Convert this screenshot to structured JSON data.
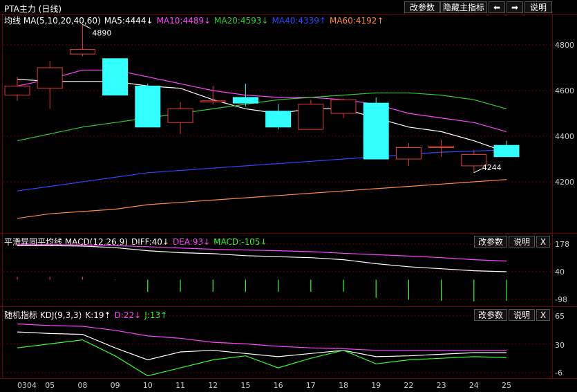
{
  "header": {
    "symbol": "PTA主力 (日线)",
    "btn_params": "改参数",
    "btn_hide": "隐藏主指标",
    "btn_left": "⬅",
    "btn_right": "➡",
    "btn_help": "说明"
  },
  "main_panel": {
    "title": "均线 MA(5,10,20,40,60)",
    "ma5": "MA5:4444↓",
    "ma10": "MA10:4489↓",
    "ma20": "MA20:4593↓",
    "ma40": "MA40:4339↑",
    "ma60": "MA60:4192↑",
    "annot_high": "4890",
    "annot_low": "4244",
    "y_ticks": [
      "4800",
      "4600",
      "4400",
      "4200"
    ]
  },
  "macd_panel": {
    "title": "平滑异同平均线 MACD(12,26,9)",
    "diff": "DIFF:40↓",
    "dea": "DEA:93↓",
    "macd": "MACD:-105↓",
    "btn_params": "改参数",
    "btn_help": "说明",
    "btn_close": "X",
    "y_ticks": [
      "178",
      "40",
      "-98"
    ]
  },
  "kdj_panel": {
    "title": "随机指标 KDJ(9,3,3)",
    "k": "K:19↑",
    "d": "D:22↓",
    "j": "J:13↑",
    "btn_params": "改参数",
    "btn_help": "说明",
    "btn_close": "X",
    "y_ticks": [
      "65",
      "30",
      "-6"
    ]
  },
  "x_axis": [
    "0304",
    "05",
    "08",
    "09",
    "10",
    "11",
    "12",
    "15",
    "16",
    "17",
    "18",
    "19",
    "22",
    "23",
    "24",
    "25"
  ],
  "colors": {
    "up": "#e83a3a",
    "down": "#33ffff",
    "ma5": "#ffffff",
    "ma10": "#ff44ff",
    "ma20": "#33cc33",
    "ma40": "#3344ff",
    "ma60": "#ff8844",
    "dea": "#ff44ff",
    "diff": "#ffffff",
    "macd_bar": "#33ff33",
    "grid": "#6e0000",
    "yellow": "#ffff44"
  },
  "chart_data": [
    {
      "type": "candlestick",
      "title": "均线 MA(5,10,20,40,60)",
      "ylim": [
        4000,
        4900
      ],
      "x": [
        "0304",
        "05",
        "08",
        "09",
        "10",
        "11",
        "12",
        "15",
        "16",
        "17",
        "18",
        "19",
        "22",
        "23",
        "24",
        "25"
      ],
      "candles": [
        {
          "open": 4580,
          "close": 4620,
          "high": 4660,
          "low": 4555
        },
        {
          "open": 4610,
          "close": 4700,
          "high": 4730,
          "low": 4520
        },
        {
          "open": 4760,
          "close": 4780,
          "high": 4890,
          "low": 4750
        },
        {
          "open": 4740,
          "close": 4580,
          "high": 4740,
          "low": 4580
        },
        {
          "open": 4620,
          "close": 4440,
          "high": 4630,
          "low": 4440
        },
        {
          "open": 4460,
          "close": 4520,
          "high": 4550,
          "low": 4410
        },
        {
          "open": 4550,
          "close": 4555,
          "high": 4620,
          "low": 4540
        },
        {
          "open": 4570,
          "close": 4545,
          "high": 4630,
          "low": 4530
        },
        {
          "open": 4510,
          "close": 4440,
          "high": 4540,
          "low": 4430
        },
        {
          "open": 4430,
          "close": 4540,
          "high": 4560,
          "low": 4430
        },
        {
          "open": 4500,
          "close": 4560,
          "high": 4565,
          "low": 4480
        },
        {
          "open": 4545,
          "close": 4300,
          "high": 4570,
          "low": 4300
        },
        {
          "open": 4300,
          "close": 4350,
          "high": 4370,
          "low": 4270
        },
        {
          "open": 4350,
          "close": 4355,
          "high": 4385,
          "low": 4310
        },
        {
          "open": 4270,
          "close": 4320,
          "high": 4340,
          "low": 4240
        },
        {
          "open": 4360,
          "close": 4310,
          "high": 4380,
          "low": 4310
        }
      ],
      "series": [
        {
          "name": "MA5",
          "values": [
            4650,
            4640,
            4640,
            4640,
            4620,
            4610,
            4560,
            4520,
            4500,
            4520,
            4520,
            4480,
            4440,
            4420,
            4380,
            4330
          ]
        },
        {
          "name": "MA10",
          "values": [
            4620,
            4650,
            4690,
            4690,
            4660,
            4630,
            4600,
            4580,
            4570,
            4570,
            4560,
            4540,
            4500,
            4480,
            4460,
            4420
          ]
        },
        {
          "name": "MA20",
          "values": [
            4380,
            4410,
            4440,
            4460,
            4480,
            4500,
            4520,
            4540,
            4560,
            4570,
            4580,
            4590,
            4590,
            4580,
            4560,
            4520
          ]
        },
        {
          "name": "MA40",
          "values": [
            4160,
            4180,
            4200,
            4220,
            4240,
            4250,
            4260,
            4270,
            4280,
            4290,
            4300,
            4310,
            4320,
            4330,
            4335,
            4340
          ]
        },
        {
          "name": "MA60",
          "values": [
            4040,
            4060,
            4070,
            4080,
            4100,
            4110,
            4120,
            4130,
            4140,
            4150,
            4160,
            4170,
            4180,
            4190,
            4200,
            4210
          ]
        }
      ]
    },
    {
      "type": "bar",
      "title": "平滑异同平均线 MACD(12,26,9)",
      "ylim": [
        -150,
        200
      ],
      "x": [
        "0304",
        "05",
        "08",
        "09",
        "10",
        "11",
        "12",
        "15",
        "16",
        "17",
        "18",
        "19",
        "22",
        "23",
        "24",
        "25"
      ],
      "series": [
        {
          "name": "DIFF",
          "values": [
            170,
            170,
            168,
            160,
            145,
            135,
            130,
            120,
            115,
            110,
            100,
            80,
            65,
            55,
            45,
            40
          ]
        },
        {
          "name": "DEA",
          "values": [
            175,
            175,
            174,
            170,
            165,
            158,
            152,
            148,
            145,
            140,
            132,
            125,
            118,
            110,
            100,
            93
          ]
        },
        {
          "name": "MACD",
          "values": [
            15,
            15,
            15,
            2,
            -60,
            -60,
            -60,
            -60,
            -60,
            -60,
            -60,
            -90,
            -100,
            -105,
            -108,
            -105
          ]
        }
      ]
    },
    {
      "type": "line",
      "title": "随机指标 KDJ(9,3,3)",
      "ylim": [
        -10,
        70
      ],
      "x": [
        "0304",
        "05",
        "08",
        "09",
        "10",
        "11",
        "12",
        "15",
        "16",
        "17",
        "18",
        "19",
        "22",
        "23",
        "24",
        "25"
      ],
      "series": [
        {
          "name": "K",
          "values": [
            45,
            43,
            42,
            25,
            10,
            20,
            22,
            18,
            14,
            18,
            22,
            14,
            15,
            17,
            19,
            19
          ]
        },
        {
          "name": "D",
          "values": [
            55,
            53,
            52,
            47,
            40,
            37,
            32,
            30,
            27,
            25,
            24,
            22,
            22,
            22,
            22,
            22
          ]
        },
        {
          "name": "J",
          "values": [
            25,
            30,
            35,
            15,
            -10,
            0,
            10,
            15,
            0,
            12,
            22,
            5,
            10,
            12,
            14,
            13
          ]
        }
      ]
    }
  ]
}
